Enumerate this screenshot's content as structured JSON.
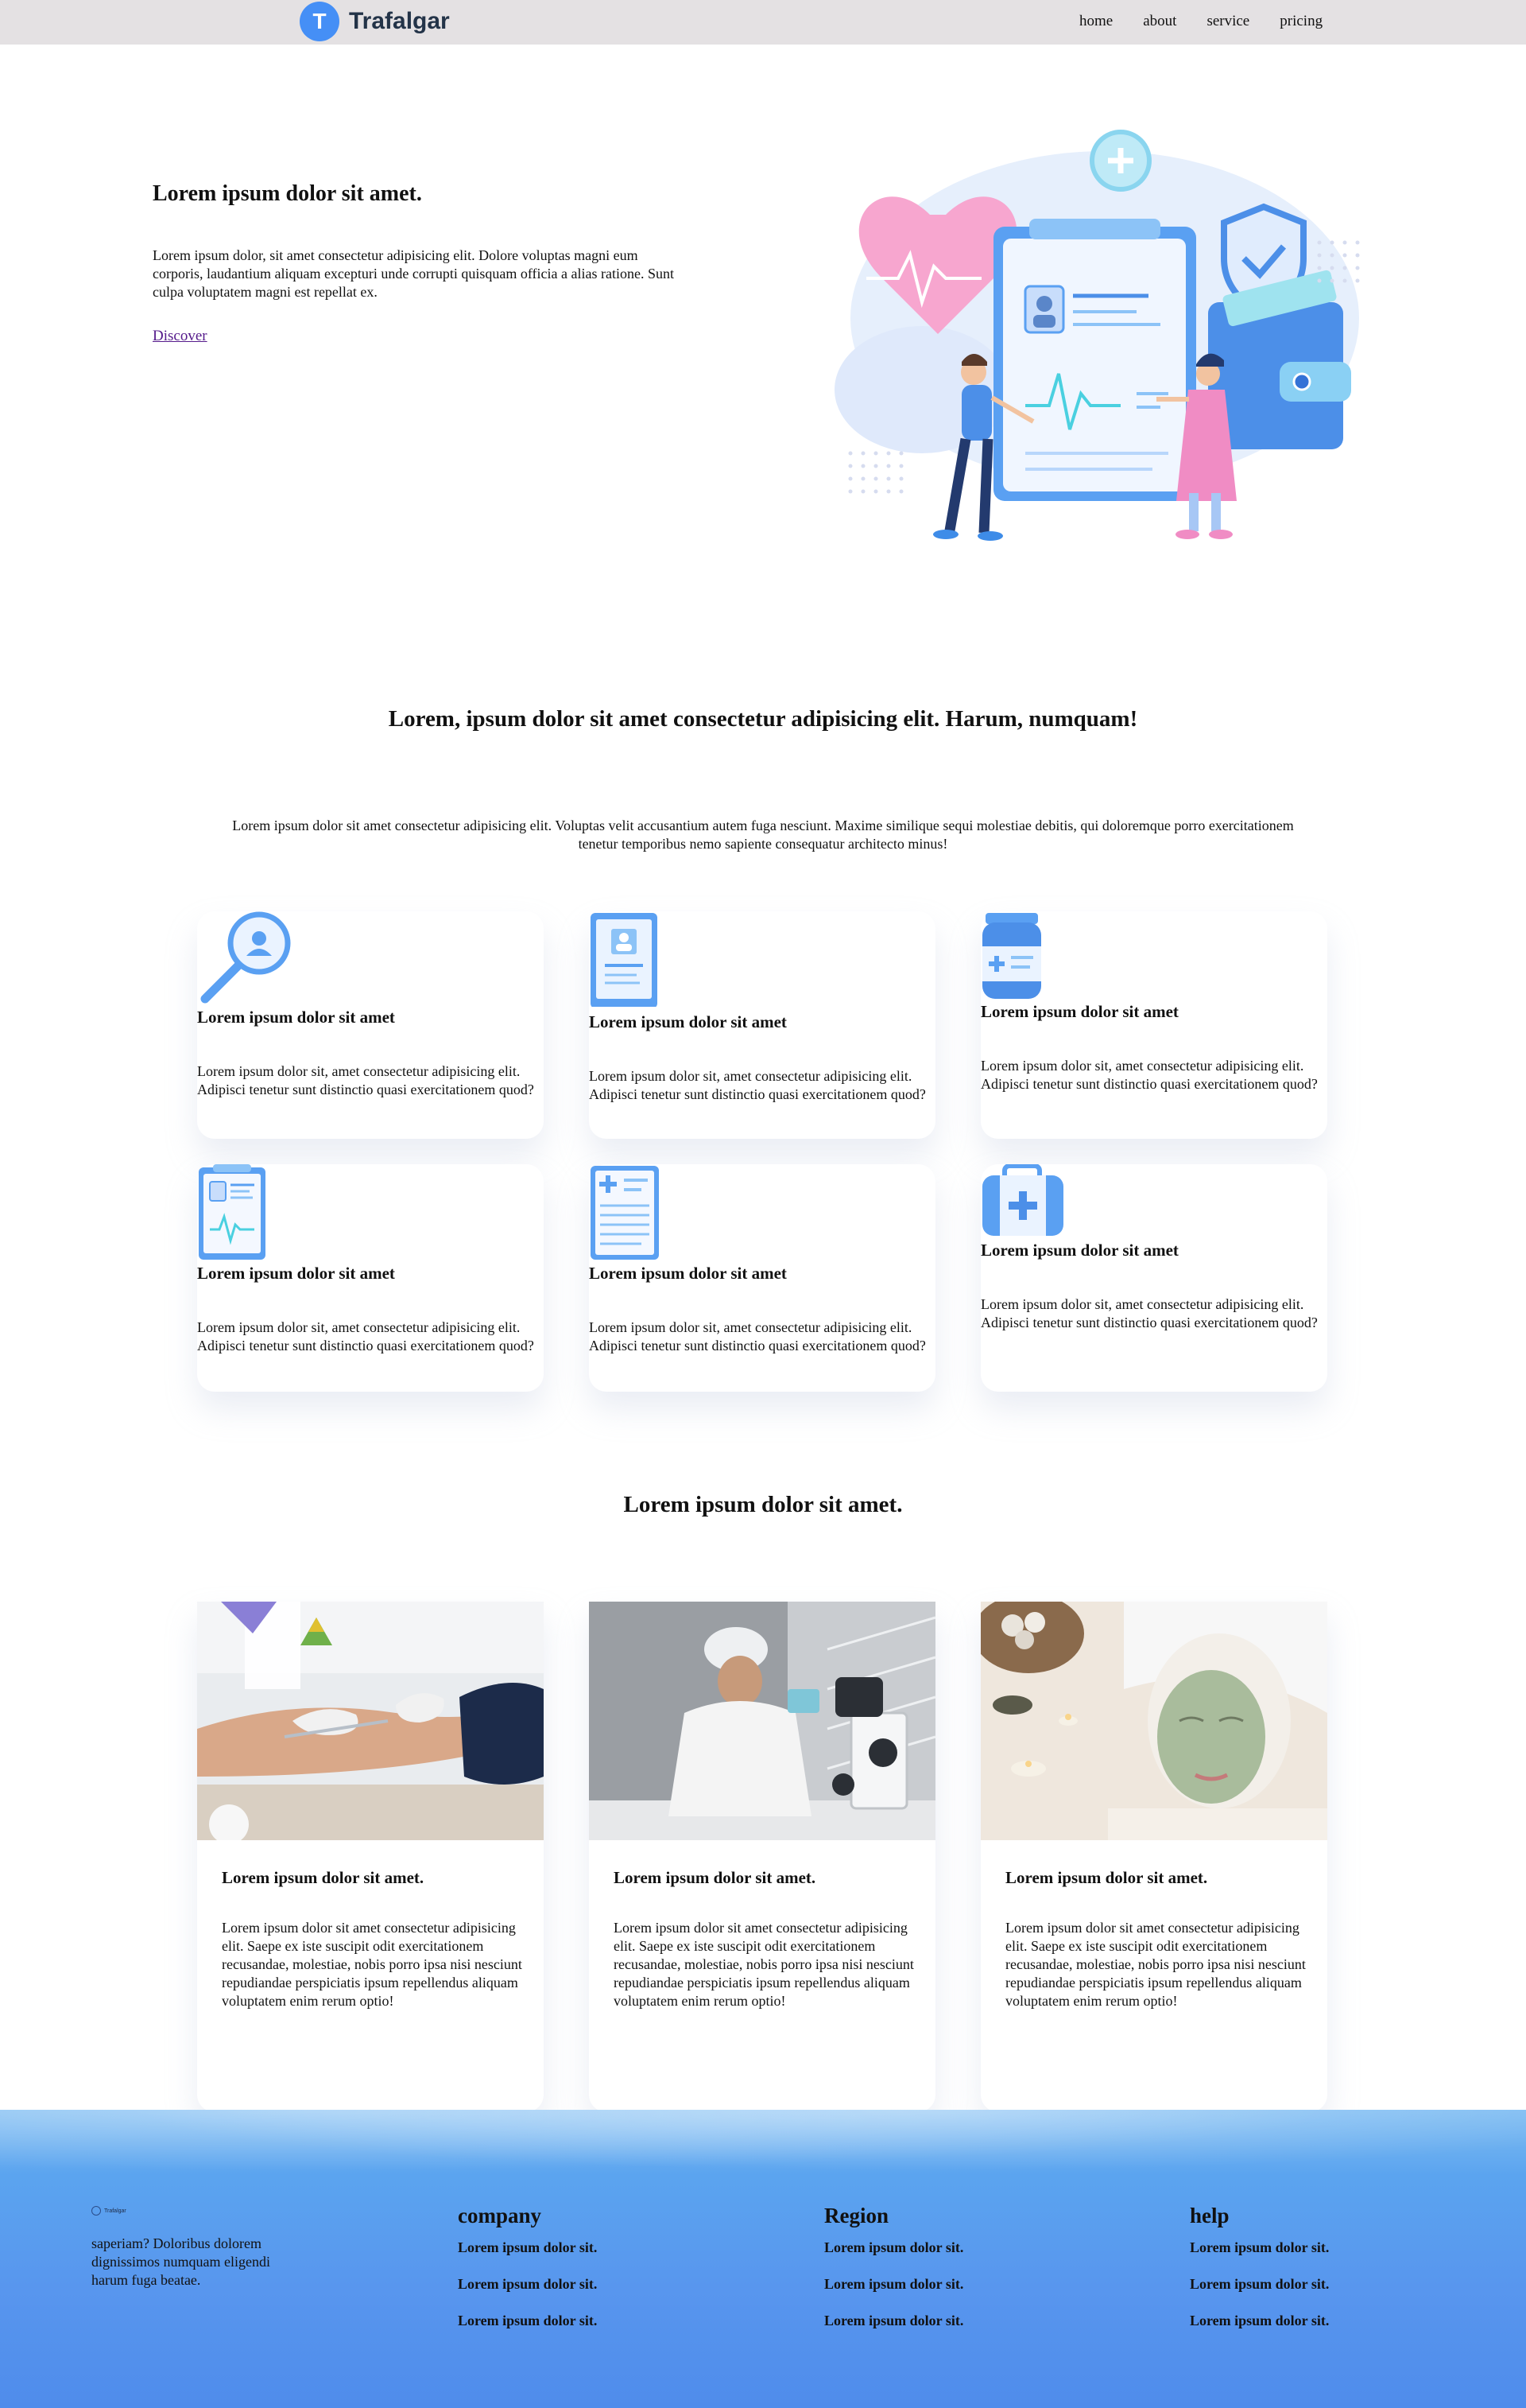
{
  "nav": {
    "logo_letter": "T",
    "brand": "Trafalgar",
    "links": [
      "home",
      "about",
      "service",
      "pricing"
    ]
  },
  "hero": {
    "title": "Lorem ipsum dolor sit amet.",
    "text": "Lorem ipsum dolor, sit amet consectetur adipisicing elit. Dolore voluptas magni eum corporis, laudantium aliquam excepturi unde corrupti quisquam officia a alias ratione. Sunt culpa voluptatem magni est repellat ex.",
    "link": "Discover"
  },
  "services_section": {
    "title": "Lorem, ipsum dolor sit amet consectetur adipisicing elit. Harum, numquam!",
    "text": "Lorem ipsum dolor sit amet consectetur adipisicing elit. Voluptas velit accusantium autem fuga nesciunt. Maxime similique sequi molestiae debitis, qui doloremque porro exercitationem tenetur temporibus nemo sapiente consequatur architecto minus!",
    "cards": [
      {
        "icon": "search-doctor-icon",
        "title": "Lorem ipsum dolor sit amet",
        "text": "Lorem ipsum dolor sit, amet consectetur adipisicing elit. Adipisci tenetur sunt distinctio quasi exercitationem quod?"
      },
      {
        "icon": "tablet-profile-icon",
        "title": "Lorem ipsum dolor sit amet",
        "text": "Lorem ipsum dolor sit, amet consectetur adipisicing elit. Adipisci tenetur sunt distinctio quasi exercitationem quod?"
      },
      {
        "icon": "medicine-bottle-icon",
        "title": "Lorem ipsum dolor sit amet",
        "text": "Lorem ipsum dolor sit, amet consectetur adipisicing elit. Adipisci tenetur sunt distinctio quasi exercitationem quod?"
      },
      {
        "icon": "clipboard-pulse-icon",
        "title": "Lorem ipsum dolor sit amet",
        "text": "Lorem ipsum dolor sit, amet consectetur adipisicing elit. Adipisci tenetur sunt distinctio quasi exercitationem quod?"
      },
      {
        "icon": "medical-report-icon",
        "title": "Lorem ipsum dolor sit amet",
        "text": "Lorem ipsum dolor sit, amet consectetur adipisicing elit. Adipisci tenetur sunt distinctio quasi exercitationem quod?"
      },
      {
        "icon": "first-aid-kit-icon",
        "title": "Lorem ipsum dolor sit amet",
        "text": "Lorem ipsum dolor sit, amet consectetur adipisicing elit. Adipisci tenetur sunt distinctio quasi exercitationem quod?"
      }
    ]
  },
  "articles_section": {
    "title": "Lorem ipsum dolor sit amet.",
    "cards": [
      {
        "image": "blood-test-photo",
        "title": "Lorem ipsum dolor sit amet.",
        "text": "Lorem ipsum dolor sit amet consectetur adipisicing elit. Saepe ex iste suscipit odit exercitationem recusandae, molestiae, nobis porro ipsa nisi nesciunt repudiandae perspiciatis ipsum repellendus aliquam voluptatem enim rerum optio!"
      },
      {
        "image": "lab-microscope-photo",
        "title": "Lorem ipsum dolor sit amet.",
        "text": "Lorem ipsum dolor sit amet consectetur adipisicing elit. Saepe ex iste suscipit odit exercitationem recusandae, molestiae, nobis porro ipsa nisi nesciunt repudiandae perspiciatis ipsum repellendus aliquam voluptatem enim rerum optio!"
      },
      {
        "image": "spa-facial-photo",
        "title": "Lorem ipsum dolor sit amet.",
        "text": "Lorem ipsum dolor sit amet consectetur adipisicing elit. Saepe ex iste suscipit odit exercitationem recusandae, molestiae, nobis porro ipsa nisi nesciunt repudiandae perspiciatis ipsum repellendus aliquam voluptatem enim rerum optio!"
      }
    ]
  },
  "footer": {
    "brand": "Trafalgar",
    "text": "saperiam? Doloribus dolorem dignissimos numquam eligendi harum fuga beatae.",
    "columns": [
      {
        "title": "company",
        "links": [
          "Lorem ipsum dolor sit.",
          "Lorem ipsum dolor sit.",
          "Lorem ipsum dolor sit."
        ]
      },
      {
        "title": "Region",
        "links": [
          "Lorem ipsum dolor sit.",
          "Lorem ipsum dolor sit.",
          "Lorem ipsum dolor sit."
        ]
      },
      {
        "title": "help",
        "links": [
          "Lorem ipsum dolor sit.",
          "Lorem ipsum dolor sit.",
          "Lorem ipsum dolor sit."
        ]
      }
    ]
  },
  "colors": {
    "accent": "#458ff6",
    "nav_bg": "#e4e1e3",
    "footer_bg": "#5b9bef"
  }
}
